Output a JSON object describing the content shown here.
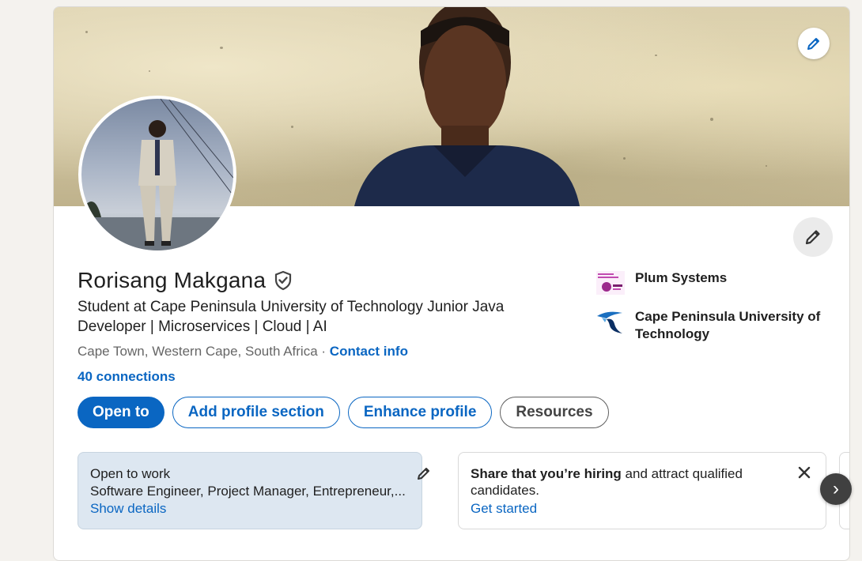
{
  "profile": {
    "name": "Rorisang Makgana",
    "headline": "Student at Cape Peninsula University of Technology Junior Java Developer | Microservices | Cloud | AI",
    "location": "Cape Town, Western Cape, South Africa",
    "separator": "·",
    "contact_link": "Contact info",
    "connections": "40 connections"
  },
  "buttons": {
    "open_to": "Open to",
    "add_section": "Add profile section",
    "enhance": "Enhance profile",
    "resources": "Resources"
  },
  "organizations": [
    {
      "name": "Plum Systems"
    },
    {
      "name": "Cape Peninsula University of Technology"
    }
  ],
  "cards": {
    "open_to_work": {
      "title": "Open to work",
      "roles": "Software Engineer, Project Manager, Entrepreneur,...",
      "link": "Show details"
    },
    "hiring": {
      "bold": "Share that you’re hiring",
      "rest": " and attract qualified candidates.",
      "link": "Get started"
    }
  },
  "icons": {
    "verified": "verified-shield-icon",
    "edit": "pencil-icon",
    "close": "close-icon",
    "next": "chevron-right-icon"
  },
  "colors": {
    "brand": "#0a66c2",
    "open_to_work_bg": "#dde7f1"
  }
}
